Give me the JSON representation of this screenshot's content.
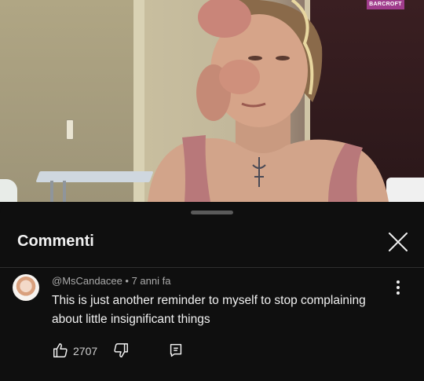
{
  "video": {
    "watermark": "BARCROFT"
  },
  "comments_panel": {
    "title": "Commenti",
    "close_icon": "close-icon"
  },
  "comment": {
    "author": "@MsCandacee",
    "separator": "•",
    "time": "7 anni fa",
    "meta": "@MsCandacee • 7 anni fa",
    "text": "This is just another reminder to myself to stop complaining about little insignificant things",
    "like_count": "2707",
    "icons": [
      "avatar",
      "more-vert-icon",
      "thumbs-up-icon",
      "thumbs-down-icon",
      "reply-icon"
    ]
  },
  "colors": {
    "background": "#0f0f0f",
    "text_primary": "#f1f1f1",
    "text_secondary": "#aaaaaa",
    "watermark_bg": "#a03c8c"
  }
}
